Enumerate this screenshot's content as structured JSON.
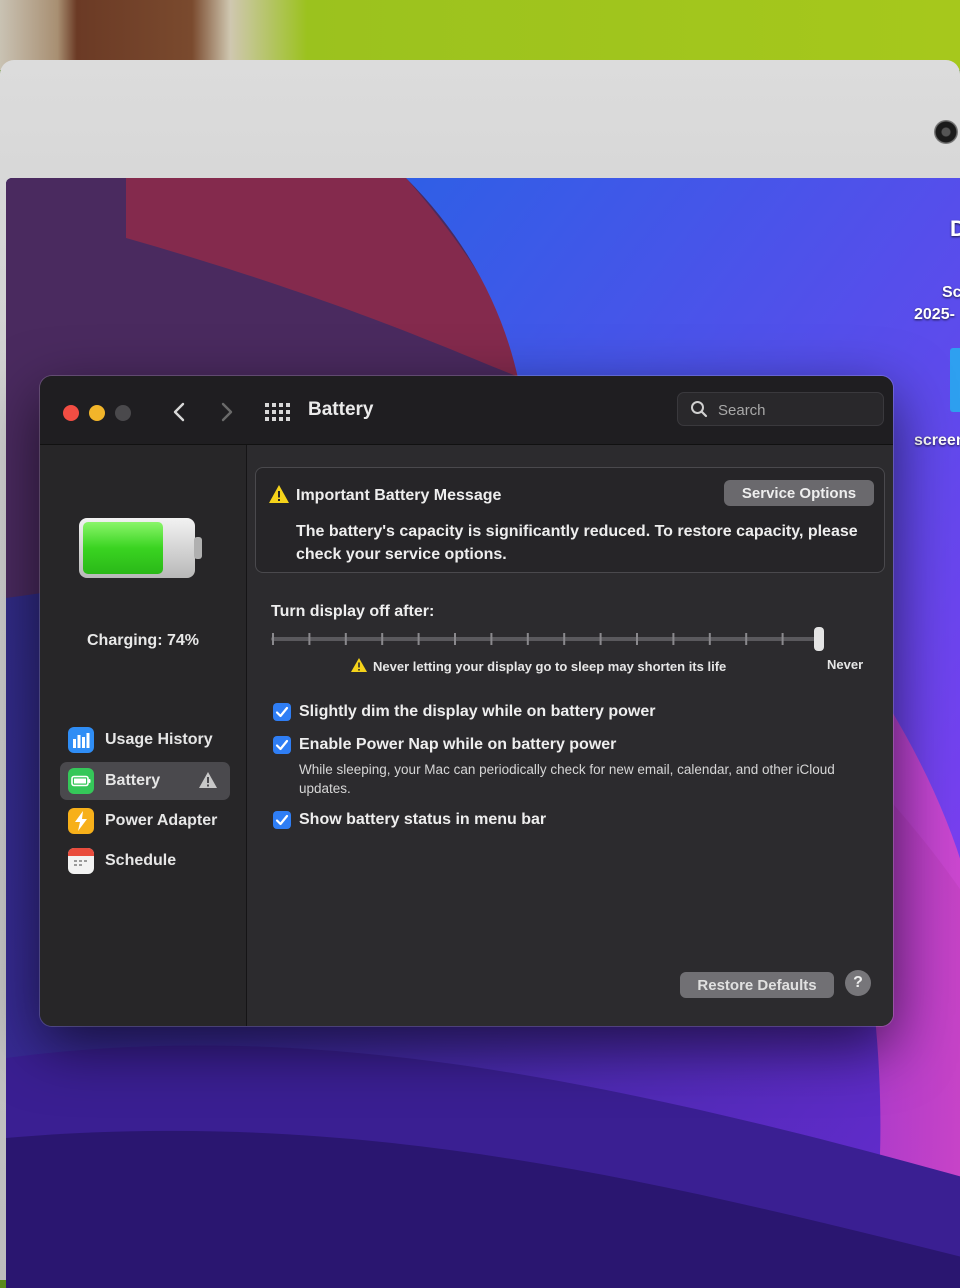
{
  "window": {
    "title": "Battery",
    "search_placeholder": "Search"
  },
  "desktop": {
    "labels": [
      "D",
      "Sc",
      "2025-",
      "screen"
    ]
  },
  "sidebar": {
    "charging_text": "Charging: 74%",
    "battery_level_percent": 74,
    "items": [
      {
        "label": "Usage History",
        "icon": "bar-chart-icon",
        "color": "#2f8df5"
      },
      {
        "label": "Battery",
        "icon": "battery-icon",
        "color": "#35c759",
        "active": true,
        "warning": true
      },
      {
        "label": "Power Adapter",
        "icon": "lightning-icon",
        "color": "#f7b01a"
      },
      {
        "label": "Schedule",
        "icon": "calendar-icon",
        "color": "#e94c3d"
      }
    ]
  },
  "alert": {
    "title": "Important Battery Message",
    "body": "The battery's capacity is significantly reduced. To restore capacity, please check your service options.",
    "button_label": "Service Options"
  },
  "display_sleep": {
    "label": "Turn display off after:",
    "ticks": 16,
    "value_index": 15,
    "warning_text": "Never letting your display go to sleep may shorten its life",
    "value_label": "Never"
  },
  "options": {
    "dim_display": {
      "label": "Slightly dim the display while on battery power",
      "checked": true
    },
    "power_nap": {
      "label": "Enable Power Nap while on battery power",
      "checked": true,
      "description": "While sleeping, your Mac can periodically check for new email, calendar, and other iCloud updates."
    },
    "show_status": {
      "label": "Show battery status in menu bar",
      "checked": true
    }
  },
  "footer": {
    "restore_label": "Restore Defaults",
    "help_label": "?"
  },
  "colors": {
    "accent": "#2f7ef5",
    "warning": "#f5d31a",
    "battery_green": "#34c92a"
  }
}
